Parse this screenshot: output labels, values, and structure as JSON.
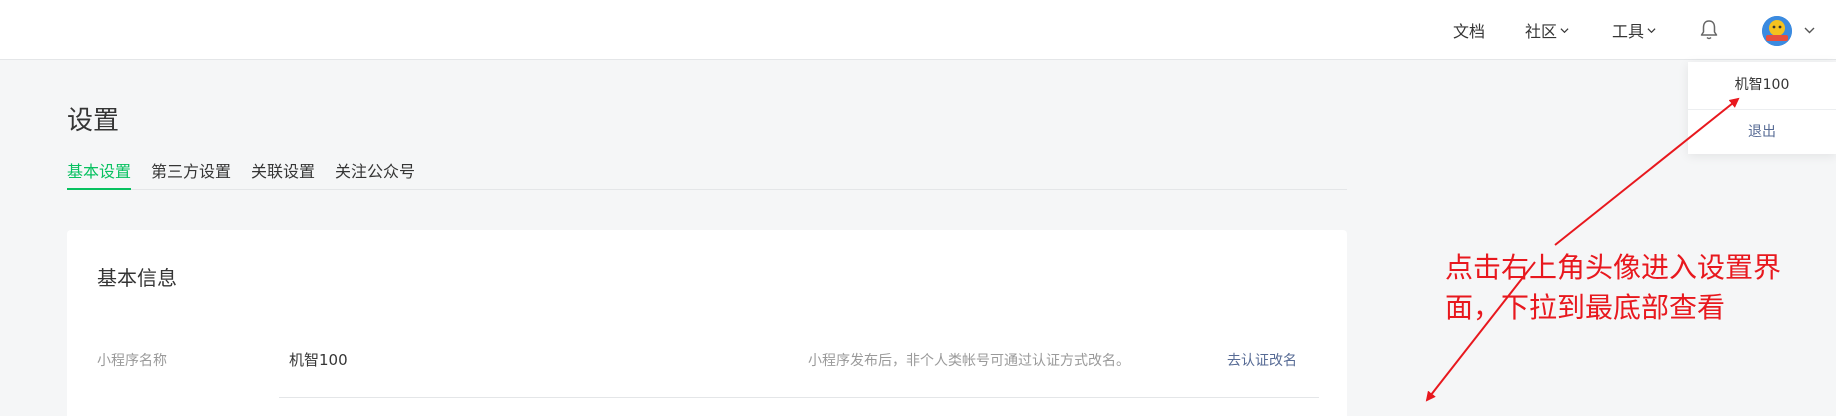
{
  "header": {
    "nav": [
      {
        "label": "文档",
        "dropdown": false
      },
      {
        "label": "社区",
        "dropdown": true
      },
      {
        "label": "工具",
        "dropdown": true
      }
    ],
    "user_menu": {
      "username": "机智100",
      "logout_label": "退出"
    }
  },
  "page": {
    "title": "设置",
    "tabs": [
      {
        "label": "基本设置",
        "active": true
      },
      {
        "label": "第三方设置",
        "active": false
      },
      {
        "label": "关联设置",
        "active": false
      },
      {
        "label": "关注公众号",
        "active": false
      }
    ]
  },
  "basic_info": {
    "section_title": "基本信息",
    "rows": [
      {
        "label": "小程序名称",
        "value": "机智100",
        "tip": "小程序发布后，非个人类帐号可通过认证方式改名。",
        "action": "去认证改名"
      }
    ]
  },
  "annotation": {
    "text_line1": "点击右上角头像进入设置界",
    "text_line2": "面，下拉到最底部查看",
    "color": "#e8181e"
  },
  "colors": {
    "accent": "#07c160",
    "link": "#576b95"
  }
}
